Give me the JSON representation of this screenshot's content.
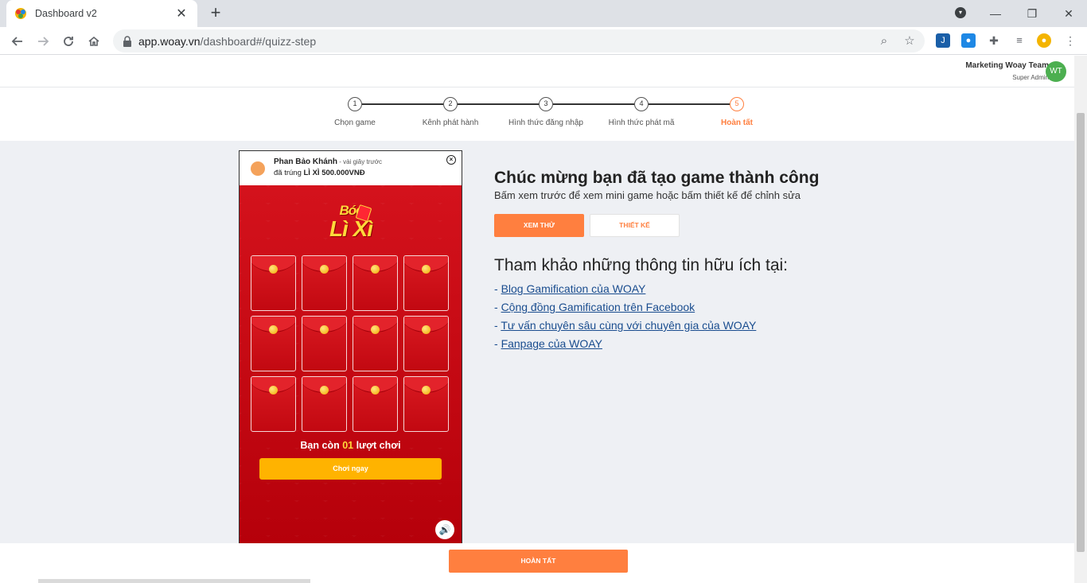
{
  "browser": {
    "tab_title": "Dashboard v2",
    "tab_close": "✕",
    "new_tab": "+",
    "url_host": "app.woay.vn",
    "url_path": "/dashboard#/quizz-step",
    "win_minimize": "—",
    "win_restore": "❐",
    "win_close": "✕"
  },
  "header": {
    "team_name": "Marketing Woay Team",
    "team_role": "Super Admin",
    "avatar_initials": "WT"
  },
  "stepper": {
    "steps": [
      {
        "number": "1",
        "label": "Chọn game"
      },
      {
        "number": "2",
        "label": "Kênh phát hành"
      },
      {
        "number": "3",
        "label": "Hình thức đăng nhập"
      },
      {
        "number": "4",
        "label": "Hình thức phát mã"
      },
      {
        "number": "5",
        "label": "Hoàn tất"
      }
    ],
    "active_step": 5
  },
  "preview": {
    "notification": {
      "name": "Phan Bảo Khánh",
      "time": " - vài giây trước",
      "message_prefix": "đã trúng ",
      "message_prize": "LÌ XÌ 500.000VNĐ"
    },
    "logo_top": "Bóc",
    "logo_bottom": "Lì Xì",
    "envelope_count": 12,
    "turns_prefix": "Bạn còn ",
    "turns_number": "01",
    "turns_suffix": " lượt chơi",
    "play_label": "Chơi ngay",
    "sound_icon": "🔊"
  },
  "main": {
    "title": "Chúc mừng bạn đã tạo game thành công",
    "subtitle": "Bấm xem trước để xem mini game hoặc bấm thiết kế để chỉnh sửa",
    "preview_button": "XEM THỬ",
    "design_button": "THIẾT KẾ",
    "ref_title": "Tham khảo những thông tin hữu ích tại:",
    "links": [
      "Blog Gamification của WOAY",
      "Cộng đồng Gamification trên Facebook",
      "Tư vấn chuyên sâu cùng với chuyên gia của WOAY",
      "Fanpage của WOAY"
    ]
  },
  "footer": {
    "finish_button": "HOÀN TẤT"
  },
  "colors": {
    "accent": "#ff7f3f",
    "game_red": "#c8000b",
    "link": "#1a4d8f",
    "avatar": "#4caf50"
  }
}
